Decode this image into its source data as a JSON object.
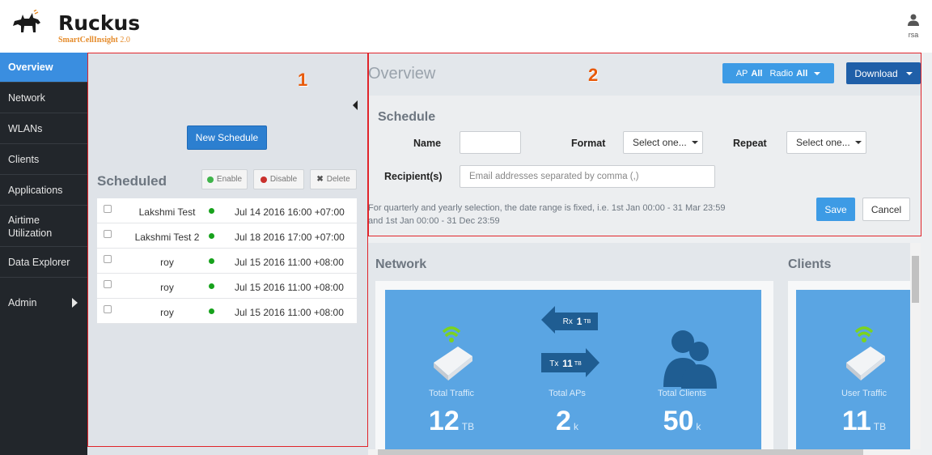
{
  "brand": {
    "name": "Ruckus",
    "product": "SmartCellInsight",
    "version": "2.0"
  },
  "user": {
    "name": "rsa"
  },
  "sidebar": {
    "items": [
      {
        "label": "Overview",
        "active": true
      },
      {
        "label": "Network"
      },
      {
        "label": "WLANs"
      },
      {
        "label": "Clients"
      },
      {
        "label": "Applications"
      },
      {
        "label": "Airtime Utilization"
      },
      {
        "label": "Data Explorer"
      },
      {
        "label": "Admin"
      }
    ]
  },
  "annotations": {
    "one": "1",
    "two": "2"
  },
  "schedules": {
    "new_button": "New Schedule",
    "title": "Scheduled",
    "enable": "Enable",
    "disable": "Disable",
    "delete": "Delete",
    "rows": [
      {
        "name": "Lakshmi Test",
        "date": "Jul 14 2016 16:00 +07:00"
      },
      {
        "name": "Lakshmi Test 2",
        "date": "Jul 18 2016 17:00 +07:00"
      },
      {
        "name": "roy",
        "date": "Jul 15 2016 11:00 +08:00"
      },
      {
        "name": "roy",
        "date": "Jul 15 2016 11:00 +08:00"
      },
      {
        "name": "roy",
        "date": "Jul 15 2016 11:00 +08:00"
      }
    ],
    "status_color": "#17a21c"
  },
  "overview": {
    "title": "Overview",
    "filter": {
      "ap_label": "AP",
      "ap_value": "All",
      "radio_label": "Radio",
      "radio_value": "All"
    },
    "download": "Download"
  },
  "schedule_form": {
    "heading": "Schedule",
    "name_label": "Name",
    "name_value": "",
    "format_label": "Format",
    "format_value": "Select one...",
    "repeat_label": "Repeat",
    "repeat_value": "Select one...",
    "recipients_label": "Recipient(s)",
    "recipients_placeholder": "Email addresses separated by comma (,)",
    "note": "For quarterly and yearly selection, the date range is fixed, i.e. 1st Jan 00:00 - 31 Mar 23:59 and 1st Jan 00:00 - 31 Dec 23:59",
    "save": "Save",
    "cancel": "Cancel"
  },
  "dashboard": {
    "network_title": "Network",
    "clients_title": "Clients",
    "rx_label": "Rx",
    "rx_value": "1",
    "rx_unit": "TB",
    "tx_label": "Tx",
    "tx_value": "11",
    "tx_unit": "TB",
    "metrics": [
      {
        "label": "Total Traffic",
        "value": "12",
        "unit": "TB"
      },
      {
        "label": "Total APs",
        "value": "2",
        "unit": "k"
      },
      {
        "label": "Total Clients",
        "value": "50",
        "unit": "k"
      },
      {
        "label": "User Traffic",
        "value": "11",
        "unit": "TB"
      }
    ]
  },
  "colors": {
    "accent": "#3a8ee0",
    "sidebar": "#22262b",
    "highlight_border": "#e0242a",
    "annotation_number": "#e85a0a",
    "card": "#5aa5e3"
  }
}
